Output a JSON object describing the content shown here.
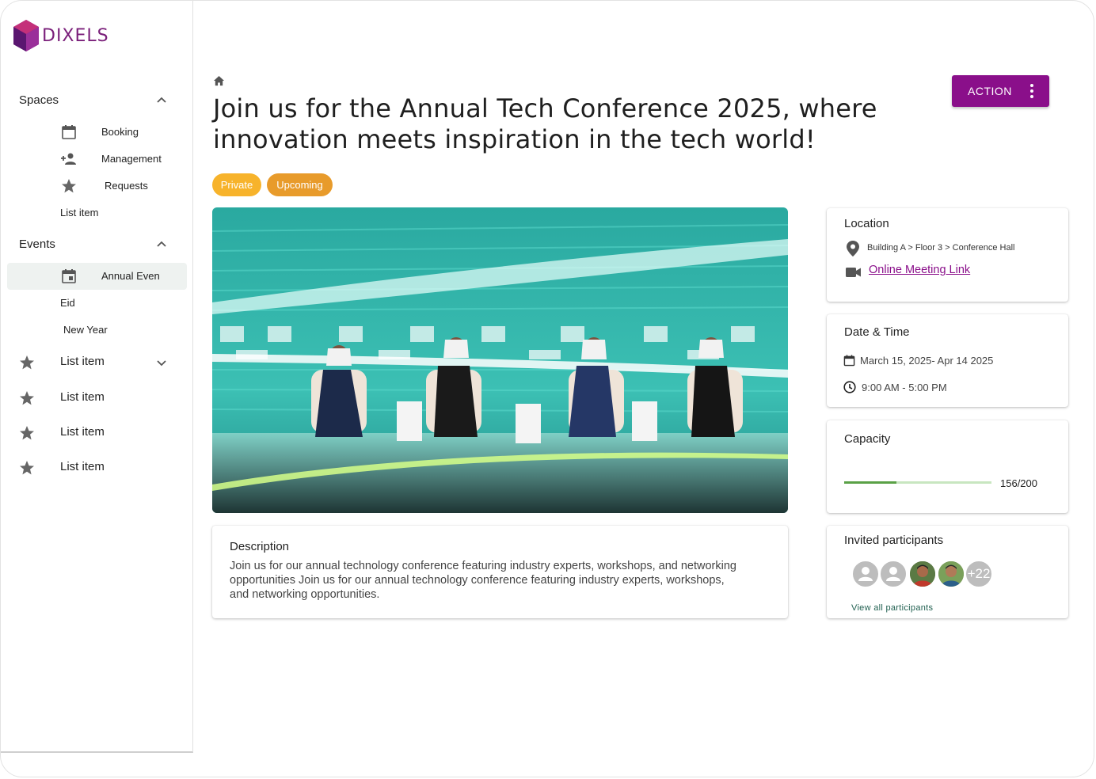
{
  "brand": {
    "name": "DIXELS"
  },
  "sidebar": {
    "spaces": {
      "label": "Spaces",
      "items": [
        {
          "label": "Booking",
          "icon": "calendar-icon"
        },
        {
          "label": "Management",
          "icon": "person-add-icon"
        },
        {
          "label": "Requests",
          "icon": "star-icon"
        },
        {
          "label": "List item"
        }
      ]
    },
    "events": {
      "label": "Events",
      "items": [
        {
          "label": "Annual Even",
          "icon": "event-icon",
          "active": true
        },
        {
          "label": "Eid"
        },
        {
          "label": "New Year"
        }
      ]
    },
    "list_items": [
      {
        "label": "List item",
        "icon": "star-icon",
        "expandable": true
      },
      {
        "label": "List item",
        "icon": "star-icon"
      },
      {
        "label": "List item",
        "icon": "star-icon"
      },
      {
        "label": "List item",
        "icon": "star-icon"
      }
    ]
  },
  "header": {
    "title": "Join us for the Annual Tech Conference 2025, where innovation meets inspiration in the tech world!",
    "action_label": "ACTION"
  },
  "badges": [
    {
      "label": "Private",
      "color": "#f7b32b"
    },
    {
      "label": "Upcoming",
      "color": "#e89b2b"
    }
  ],
  "description": {
    "title": "Description",
    "text": "Join us for our annual technology conference featuring industry experts, workshops, and networking opportunities Join us for our annual technology conference featuring industry experts, workshops, and networking opportunities."
  },
  "location": {
    "title": "Location",
    "address": "Building A > Floor 3 > Conference Hall",
    "meeting_link": "Online Meeting Link"
  },
  "datetime": {
    "title": "Date & Time",
    "dates": "March 15, 2025- Apr 14 2025",
    "hours": "9:00 AM - 5:00 PM"
  },
  "capacity": {
    "title": "Capacity",
    "value": "156/200",
    "fraction": 0.78
  },
  "participants": {
    "title": "Invited participants",
    "more_count": "+22",
    "view_all": "View all participants"
  },
  "colors": {
    "accent": "#8a0f8a",
    "progress": "#5aa146"
  }
}
